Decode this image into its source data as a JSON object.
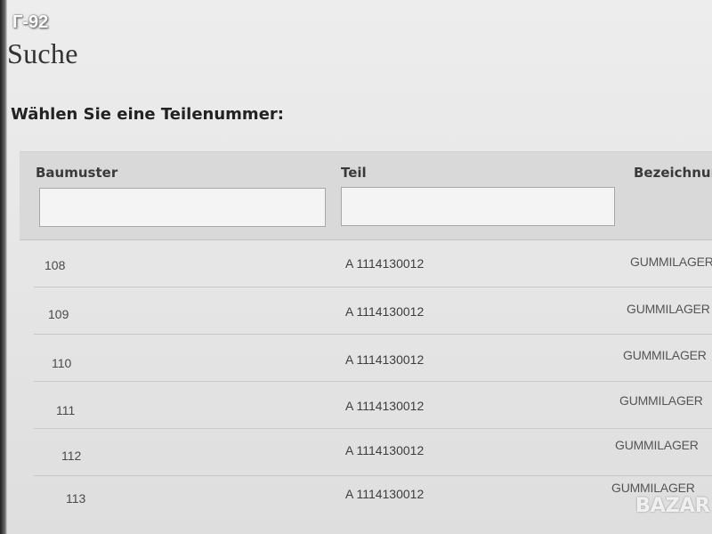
{
  "watermark": {
    "top_label": "Г-92",
    "logo": "BAZAR"
  },
  "page": {
    "title": "Suche",
    "section_heading": "Wählen Sie eine Teilenummer:"
  },
  "table": {
    "columns": {
      "baumuster": "Baumuster",
      "teil": "Teil",
      "bezeichnung": "Bezeichnun"
    },
    "filters": {
      "baumuster_value": "",
      "teil_value": ""
    },
    "rows": [
      {
        "baumuster": "108",
        "teil": "A 1114130012",
        "bezeichnung": "GUMMILAGER"
      },
      {
        "baumuster": "109",
        "teil": "A 1114130012",
        "bezeichnung": "GUMMILAGER"
      },
      {
        "baumuster": "110",
        "teil": "A 1114130012",
        "bezeichnung": "GUMMILAGER"
      },
      {
        "baumuster": "111",
        "teil": "A 1114130012",
        "bezeichnung": "GUMMILAGER"
      },
      {
        "baumuster": "112",
        "teil": "A 1114130012",
        "bezeichnung": "GUMMILAGER"
      },
      {
        "baumuster": "113",
        "teil": "A 1114130012",
        "bezeichnung": "GUMMILAGER"
      }
    ]
  }
}
